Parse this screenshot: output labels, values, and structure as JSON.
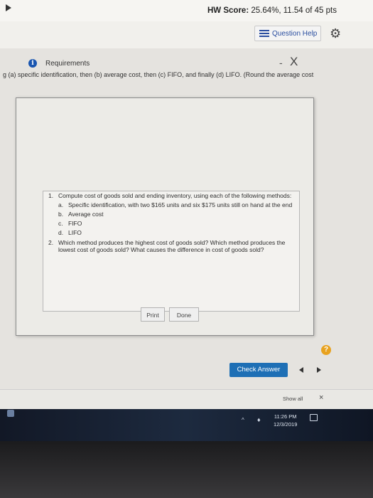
{
  "header": {
    "hw_score_label": "HW Score:",
    "hw_score_value": "25.64%, 11.54 of 45 pts"
  },
  "toolbar": {
    "question_help_label": "Question Help"
  },
  "instructions": "g (a) specific identification, then (b) average cost, then (c) FIFO, and finally (d) LIFO. (Round the average cost",
  "modal": {
    "title": "Requirements",
    "minimize_label": "-",
    "close_label": "X",
    "items": [
      {
        "num": "1.",
        "text": "Compute cost of goods sold and ending inventory, using each of the following methods:",
        "sub": [
          {
            "letter": "a.",
            "text": "Specific identification, with two $165 units and six $175 units still on hand at the end"
          },
          {
            "letter": "b.",
            "text": "Average cost"
          },
          {
            "letter": "c.",
            "text": "FIFO"
          },
          {
            "letter": "d.",
            "text": "LIFO"
          }
        ]
      },
      {
        "num": "2.",
        "text": "Which method produces the highest cost of goods sold? Which method produces the lowest cost of goods sold? What causes the difference in cost of goods sold?"
      }
    ],
    "print_label": "Print",
    "done_label": "Done"
  },
  "footer": {
    "help_symbol": "?",
    "check_answer_label": "Check Answer"
  },
  "download_bar": {
    "show_all_label": "Show all",
    "close_label": "×"
  },
  "taskbar": {
    "time": "11:26 PM",
    "date": "12/3/2019"
  },
  "colors": {
    "accent": "#1e6fb5",
    "help_icon": "#e8a21f",
    "info_icon": "#1a56b0"
  }
}
